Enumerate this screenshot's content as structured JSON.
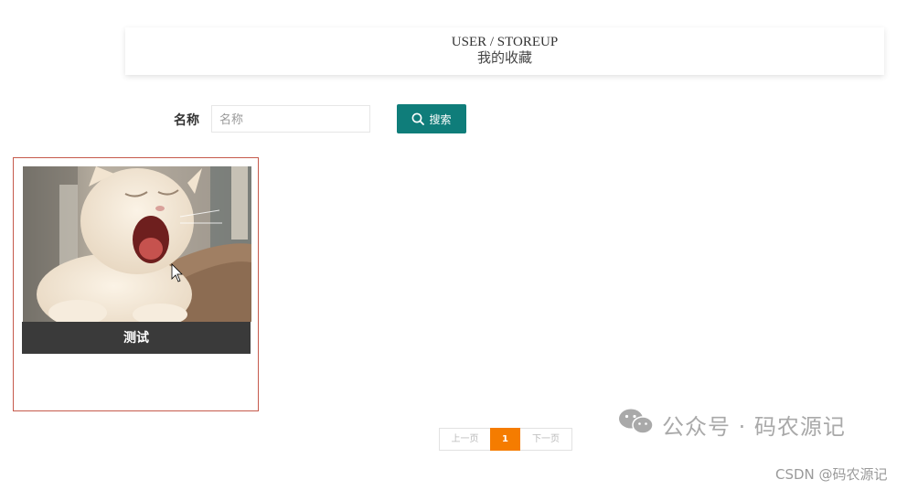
{
  "header": {
    "breadcrumb": "USER / STOREUP",
    "title": "我的收藏"
  },
  "search": {
    "label": "名称",
    "placeholder": "名称",
    "value": "",
    "button_label": "搜索",
    "button_icon": "search-icon"
  },
  "favorites": [
    {
      "caption": "测试",
      "image": "yawning-white-cat-photo"
    }
  ],
  "pagination": {
    "prev_label": "上一页",
    "current_page": "1",
    "next_label": "下一页"
  },
  "watermarks": {
    "wechat": "公众号 · 码农源记",
    "csdn": "CSDN @码农源记"
  },
  "colors": {
    "search_button": "#0f7d7a",
    "active_page": "#f57c00",
    "card_border": "#c65a4c",
    "caption_bg": "#3a3a3a"
  }
}
